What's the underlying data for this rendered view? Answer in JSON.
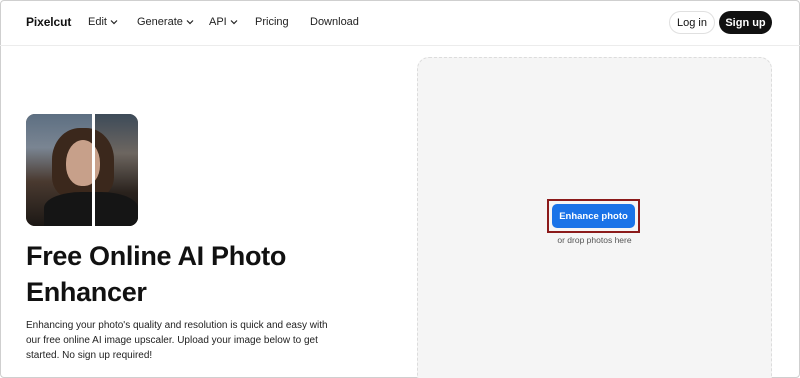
{
  "nav": {
    "logo": "Pixelcut",
    "items": [
      {
        "label": "Edit",
        "has_dropdown": true
      },
      {
        "label": "Generate",
        "has_dropdown": true
      },
      {
        "label": "API",
        "has_dropdown": true
      },
      {
        "label": "Pricing",
        "has_dropdown": false
      },
      {
        "label": "Download",
        "has_dropdown": false
      }
    ],
    "login_label": "Log in",
    "signup_label": "Sign up"
  },
  "hero": {
    "image_icon": "before-after-portrait",
    "headline": "Free Online AI Photo Enhancer",
    "subtext": "Enhancing your photo's quality and resolution is quick and easy with our free online AI image upscaler. Upload your image below to get started. No sign up required!"
  },
  "upload": {
    "button_label": "Enhance photo",
    "hint": "or drop photos here"
  },
  "colors": {
    "accent": "#1a73e8",
    "signup_bg": "#111111",
    "highlight_border": "#8b1a1a",
    "drop_zone_bg": "#f5f5f5"
  }
}
